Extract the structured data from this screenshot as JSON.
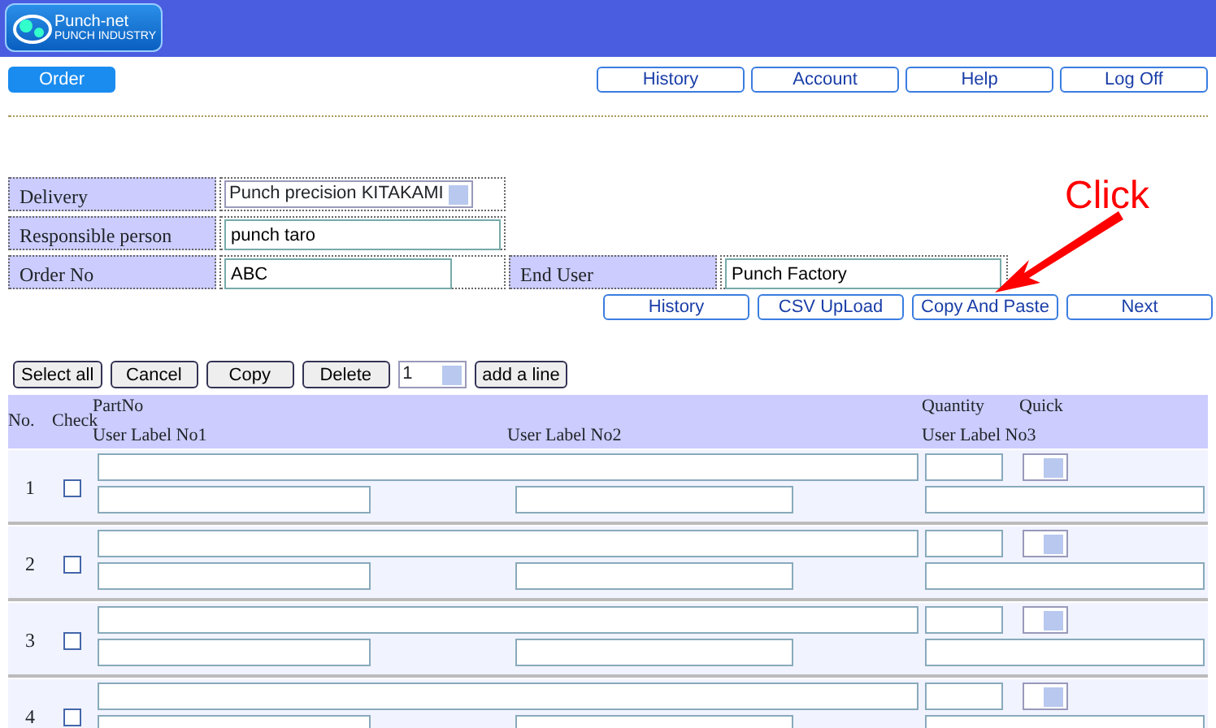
{
  "header": {
    "logo_title": "Punch-net",
    "logo_subtitle": "PUNCH INDUSTRY"
  },
  "menu": {
    "current": "Order",
    "links": [
      "History",
      "Account",
      "Help",
      "Log Off"
    ]
  },
  "form": {
    "delivery": {
      "label": "Delivery",
      "value": "Punch precision KITAKAMI"
    },
    "responsible": {
      "label": "Responsible person",
      "value": "punch taro"
    },
    "order_no": {
      "label": "Order No",
      "value": "ABC"
    },
    "end_user": {
      "label": "End User",
      "value": "Punch Factory"
    }
  },
  "actions": [
    "History",
    "CSV UpLoad",
    "Copy And Paste",
    "Next"
  ],
  "annotation": {
    "text": "Click"
  },
  "toolbar": {
    "buttons": [
      "Select all",
      "Cancel",
      "Copy",
      "Delete"
    ],
    "line_count": "1",
    "add_button": "add a line"
  },
  "table": {
    "columns": {
      "no": "No.",
      "check": "Check",
      "part": "PartNo",
      "label1": "User Label No1",
      "label2": "User Label No2",
      "quantity": "Quantity",
      "label3": "User Label No3",
      "quick": "Quick"
    },
    "rows": [
      {
        "no": "1",
        "checked": false
      },
      {
        "no": "2",
        "checked": false
      },
      {
        "no": "3",
        "checked": false
      },
      {
        "no": "4",
        "checked": false
      }
    ]
  }
}
